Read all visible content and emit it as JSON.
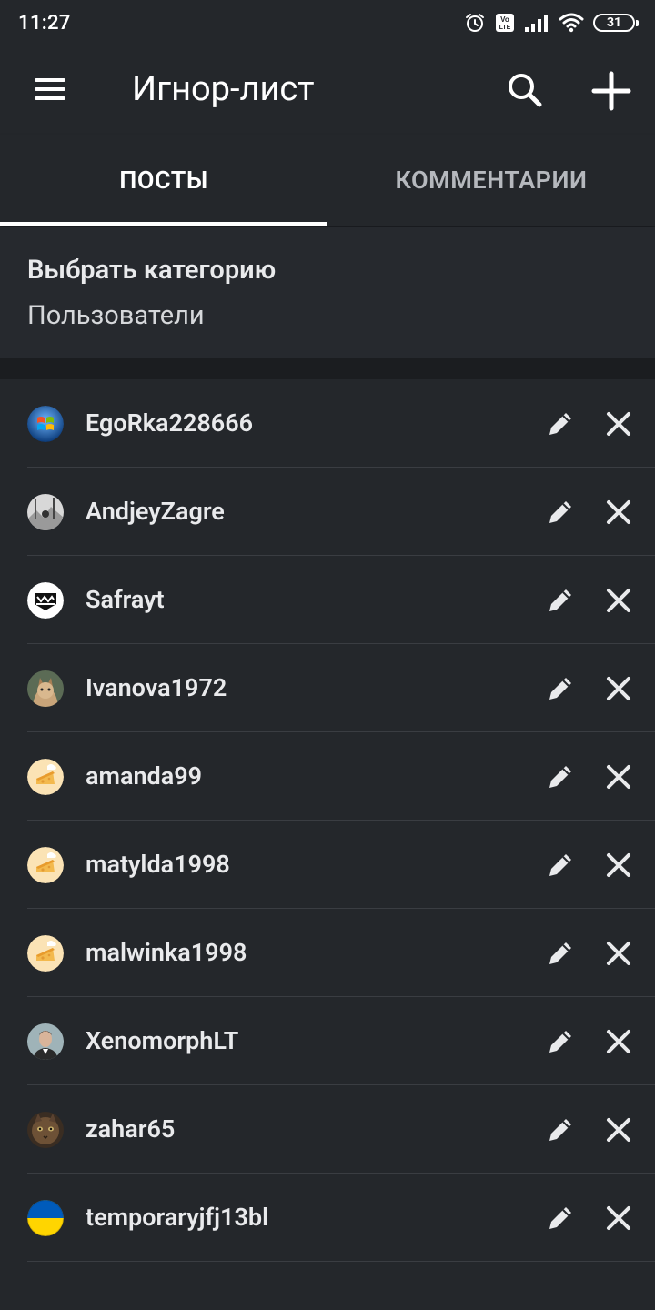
{
  "status_bar": {
    "time": "11:27",
    "battery": "31",
    "icons": [
      "alarm-icon",
      "volte-icon",
      "signal-icon",
      "wifi-icon",
      "battery-icon"
    ]
  },
  "app_bar": {
    "title": "Игнор-лист",
    "icons": [
      "menu-icon",
      "search-icon",
      "plus-icon"
    ]
  },
  "tabs": [
    {
      "label": "ПОСТЫ",
      "active": true
    },
    {
      "label": "КОММЕНТАРИИ",
      "active": false
    }
  ],
  "category": {
    "label": "Выбрать категорию",
    "value": "Пользователи"
  },
  "users": [
    {
      "name": "EgoRka228666",
      "avatar": "windows-logo"
    },
    {
      "name": "AndjeyZagre",
      "avatar": "winter-photo"
    },
    {
      "name": "Safrayt",
      "avatar": "badge-emblem"
    },
    {
      "name": "Ivanova1972",
      "avatar": "cat-photo"
    },
    {
      "name": "amanda99",
      "avatar": "default-cheese"
    },
    {
      "name": "matylda1998",
      "avatar": "default-cheese"
    },
    {
      "name": "malwinka1998",
      "avatar": "default-cheese"
    },
    {
      "name": "XenomorphLT",
      "avatar": "portrait-photo"
    },
    {
      "name": "zahar65",
      "avatar": "cat-face-photo"
    },
    {
      "name": "temporaryjfj13bl",
      "avatar": "ukraine-flag"
    }
  ],
  "row_icons": {
    "edit": "pencil-icon",
    "remove": "close-icon"
  },
  "colors": {
    "background": "#24272b",
    "category_background": "#26292e",
    "separator": "#1b1d20",
    "divider": "#3a3d42",
    "text": "#e9eaec",
    "inactive_tab": "#b5b8bd"
  }
}
